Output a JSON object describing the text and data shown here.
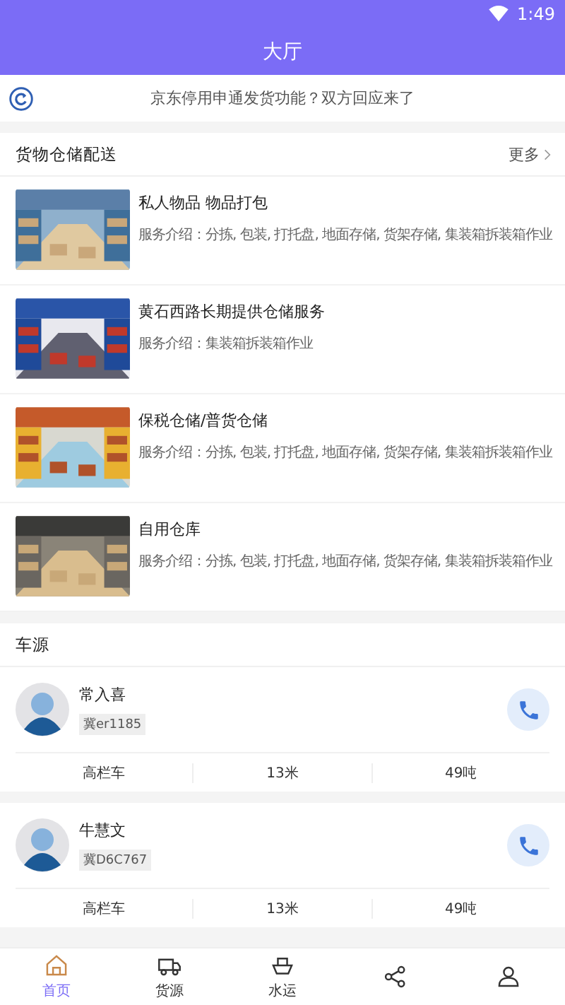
{
  "status_bar": {
    "time": "1:49"
  },
  "header": {
    "title": "大厅"
  },
  "notice": {
    "text": "京东停用申通发货功能？双方回应来了"
  },
  "storage": {
    "title": "货物仓储配送",
    "more": "更多",
    "items": [
      {
        "title": "私人物品 物品打包",
        "desc": "服务介绍：分拣, 包装, 打托盘, 地面存储, 货架存储, 集装箱拆装箱作业"
      },
      {
        "title": "黄石西路长期提供仓储服务",
        "desc": "服务介绍：集装箱拆装箱作业"
      },
      {
        "title": "保税仓储/普货仓储",
        "desc": "服务介绍：分拣, 包装, 打托盘, 地面存储, 货架存储, 集装箱拆装箱作业"
      },
      {
        "title": "自用仓库",
        "desc": "服务介绍：分拣, 包装, 打托盘, 地面存储, 货架存储, 集装箱拆装箱作业"
      }
    ]
  },
  "vehicles": {
    "title": "车源",
    "items": [
      {
        "name": "常入喜",
        "plate": "冀er1185",
        "type": "高栏车",
        "length": "13米",
        "weight": "49吨"
      },
      {
        "name": "牛慧文",
        "plate": "冀D6C767",
        "type": "高栏车",
        "length": "13米",
        "weight": "49吨"
      }
    ]
  },
  "tab_bar": [
    {
      "kind": "home",
      "label": "首页",
      "selected": true
    },
    {
      "kind": "truck",
      "label": "货源",
      "selected": false
    },
    {
      "kind": "ship",
      "label": "水运",
      "selected": false
    },
    {
      "kind": "share",
      "selected": false
    },
    {
      "kind": "person",
      "selected": false
    }
  ]
}
